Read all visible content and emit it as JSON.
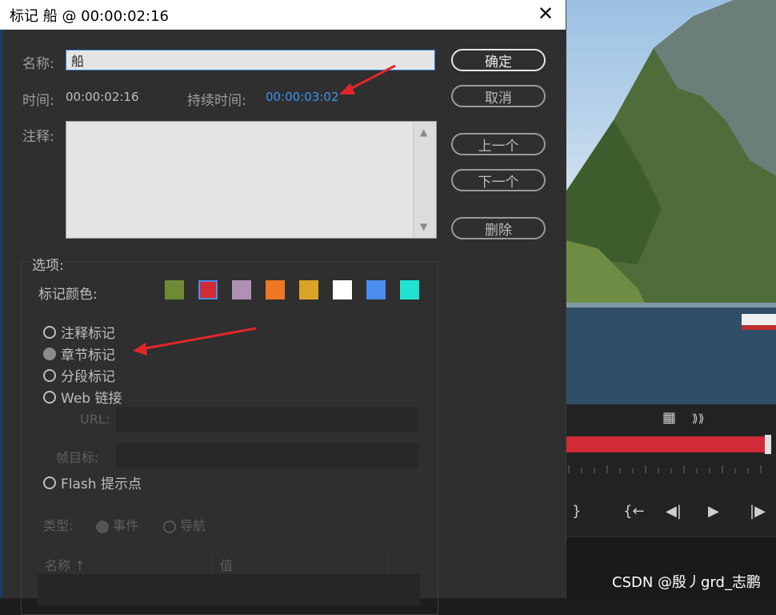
{
  "dialog": {
    "title": "标记 船 @ 00:00:02:16",
    "name_label": "名称:",
    "name_value": "船",
    "time_label": "时间:",
    "time_value": "00:00:02:16",
    "duration_label": "持续时间:",
    "duration_value": "00:00:03:02",
    "comment_label": "注释:",
    "buttons": {
      "ok": "确定",
      "cancel": "取消",
      "prev": "上一个",
      "next": "下一个",
      "delete": "删除"
    },
    "options": {
      "group_label": "选项:",
      "marker_color_label": "标记颜色:",
      "colors": [
        "#6f8a35",
        "#d12b37",
        "#b190b5",
        "#ef7622",
        "#dba228",
        "#ffffff",
        "#4a8cf0",
        "#1fe3d0"
      ],
      "selected_color_index": 1,
      "radios": [
        {
          "label": "注释标记",
          "selected": false
        },
        {
          "label": "章节标记",
          "selected": true
        },
        {
          "label": "分段标记",
          "selected": false
        },
        {
          "label": "Web 链接",
          "selected": false
        }
      ],
      "url_label": "URL:",
      "frame_target_label": "帧目标:",
      "flash_label": "Flash 提示点",
      "type_label": "类型:",
      "type_event": "事件",
      "type_nav": "导航",
      "col_name": "名称",
      "col_value": "值"
    }
  },
  "icons": {
    "close": "close-icon",
    "film": "film-icon",
    "audio": "audio-waveform-icon"
  },
  "watermark": "CSDN @殷丿grd_志鹏"
}
